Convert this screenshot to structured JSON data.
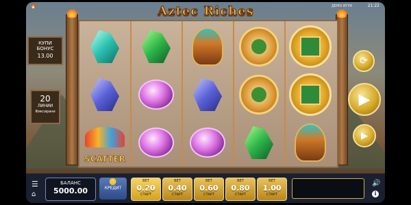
{
  "status": {
    "left_time": "",
    "right_time": "21:22",
    "demo_label": "ДЕМО ИГРА"
  },
  "game": {
    "title": "Aztec Riches"
  },
  "buy_bonus": {
    "label_line1": "КУПИ",
    "label_line2": "БОНУС",
    "price": "13.00"
  },
  "paylines": {
    "count": "20",
    "label": "ЛИНИИ",
    "mode": "Фиксирани"
  },
  "reels": [
    [
      "teal-crystal",
      "blue-crystal",
      "scatter"
    ],
    [
      "green-crystal",
      "pink-orb",
      "pink-orb"
    ],
    [
      "aztec-mask",
      "blue-crystal",
      "pink-orb"
    ],
    [
      "green-feather-medal",
      "green-feather-medal",
      "green-crystal"
    ],
    [
      "aztec-sun-medal",
      "aztec-sun-medal",
      "aztec-mask"
    ]
  ],
  "scatter_label": "SCATTER",
  "balance": {
    "label": "БАЛАНС",
    "value": "5000.00"
  },
  "credit": {
    "label": "КРЕДИТ"
  },
  "bets": [
    {
      "top": "BET",
      "value": "0.20",
      "bottom": "СТАРТ"
    },
    {
      "top": "BET",
      "value": "0.40",
      "bottom": "СТАРТ"
    },
    {
      "top": "BET",
      "value": "0.60",
      "bottom": "СТАРТ"
    },
    {
      "top": "BET",
      "value": "0.80",
      "bottom": "СТАРТ"
    },
    {
      "top": "BET",
      "value": "1.00",
      "bottom": "СТАРТ"
    }
  ],
  "colors": {
    "gold": "#d6a927",
    "panel": "#1a2030"
  }
}
